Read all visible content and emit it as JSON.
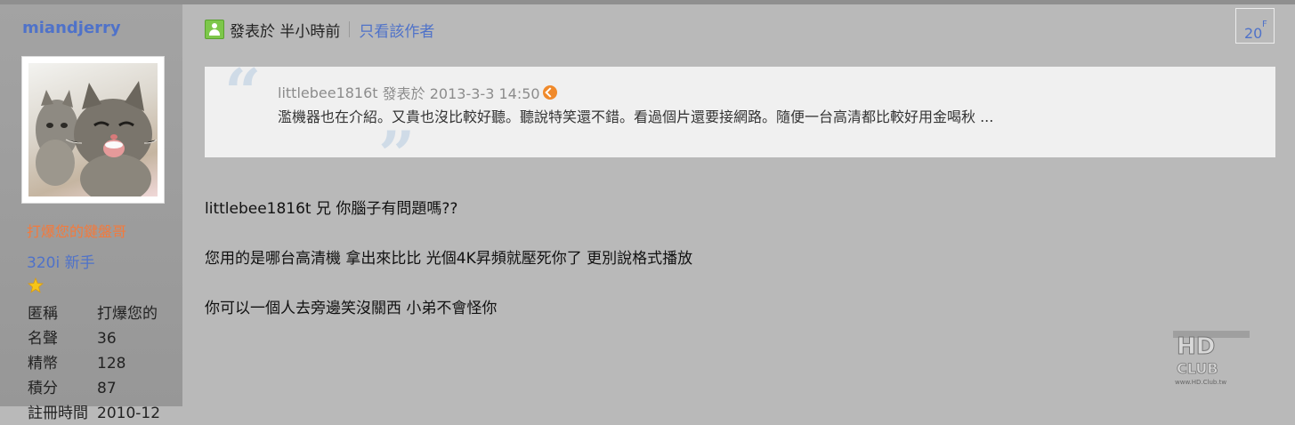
{
  "user": {
    "name": "miandjerry",
    "title": "打爆您的鍵盤哥",
    "rank": "320i 新手",
    "stats": [
      {
        "label": "匿稱",
        "value": "打爆您的"
      },
      {
        "label": "名聲",
        "value": "36"
      },
      {
        "label": "精幣",
        "value": "128"
      },
      {
        "label": "積分",
        "value": "87"
      },
      {
        "label": "註冊時間",
        "value": "2010-12"
      }
    ]
  },
  "post": {
    "time_text": "發表於 半小時前",
    "author_only": "只看該作者",
    "floor": "20",
    "floor_suffix": "F",
    "quote": {
      "author": "littlebee1816t",
      "time": "發表於 2013-3-3 14:50",
      "text": "濫機器也在介紹。又貴也沒比較好聽。聽說特笑還不錯。看過個片還要接網路。隨便一台高清都比較好用金喝秋 ..."
    },
    "lines": [
      "littlebee1816t 兄 你腦子有問題嗎??",
      "您用的是哪台高清機 拿出來比比 光個4K昇頻就壓死你了 更別說格式播放",
      "你可以一個人去旁邊笑沒關西 小弟不會怪你"
    ]
  },
  "watermark": {
    "text": "HD CLUB",
    "url_text": "www.HD.Club.tw"
  },
  "colors": {
    "link": "#4f72c9",
    "title_orange": "#f37a3c",
    "background": "#b9b9b9",
    "quote_bg": "#f0f0f0"
  },
  "icons": [
    "online-status-icon",
    "star-icon",
    "back-to-quote-icon"
  ]
}
